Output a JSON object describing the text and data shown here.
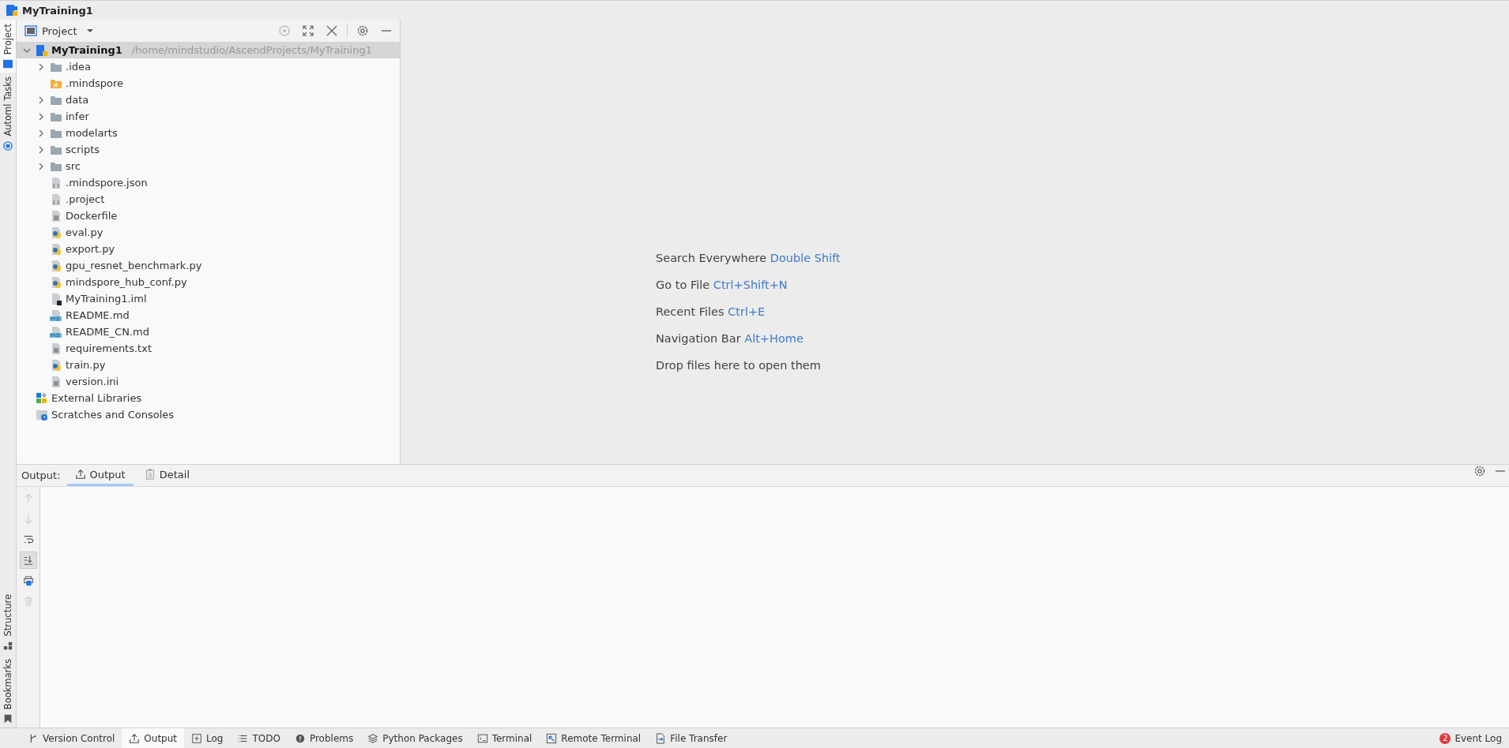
{
  "window": {
    "title": "MyTraining1"
  },
  "side_tabs_top": [
    {
      "label": "Project",
      "kind": "project",
      "selected": true
    },
    {
      "label": "Automl Tasks",
      "kind": "automl",
      "selected": false
    }
  ],
  "side_tabs_bottom": [
    {
      "label": "Structure",
      "kind": "structure",
      "selected": false
    },
    {
      "label": "Bookmarks",
      "kind": "bookmarks",
      "selected": false
    }
  ],
  "project_panel": {
    "view": "Project",
    "tree": [
      {
        "name": "MyTraining1",
        "path": "/home/mindstudio/AscendProjects/MyTraining1",
        "kind": "module",
        "expanded": true,
        "selected": true,
        "children": [
          {
            "name": ".idea",
            "kind": "folder",
            "expanded": false,
            "selected": false
          },
          {
            "name": ".mindspore",
            "kind": "mindspore",
            "selected": false
          },
          {
            "name": "data",
            "kind": "folder",
            "expanded": false,
            "selected": false
          },
          {
            "name": "infer",
            "kind": "folder",
            "expanded": false,
            "selected": false
          },
          {
            "name": "modelarts",
            "kind": "folder",
            "expanded": false,
            "selected": false
          },
          {
            "name": "scripts",
            "kind": "folder",
            "expanded": false,
            "selected": false
          },
          {
            "name": "src",
            "kind": "folder",
            "expanded": false,
            "selected": false
          },
          {
            "name": ".mindspore.json",
            "kind": "json",
            "selected": false
          },
          {
            "name": ".project",
            "kind": "project",
            "selected": false
          },
          {
            "name": "Dockerfile",
            "kind": "text",
            "selected": false
          },
          {
            "name": "eval.py",
            "kind": "python",
            "selected": false
          },
          {
            "name": "export.py",
            "kind": "python",
            "selected": false
          },
          {
            "name": "gpu_resnet_benchmark.py",
            "kind": "python",
            "selected": false
          },
          {
            "name": "mindspore_hub_conf.py",
            "kind": "python",
            "selected": false
          },
          {
            "name": "MyTraining1.iml",
            "kind": "iml",
            "selected": false
          },
          {
            "name": "README.md",
            "kind": "markdown",
            "selected": false
          },
          {
            "name": "README_CN.md",
            "kind": "markdown",
            "selected": false
          },
          {
            "name": "requirements.txt",
            "kind": "text",
            "selected": false
          },
          {
            "name": "train.py",
            "kind": "python",
            "selected": false
          },
          {
            "name": "version.ini",
            "kind": "text",
            "selected": false
          }
        ]
      },
      {
        "name": "External Libraries",
        "kind": "libraries",
        "selected": false
      },
      {
        "name": "Scratches and Consoles",
        "kind": "scratches",
        "selected": false
      }
    ]
  },
  "editor_hints": [
    {
      "action": "Search Everywhere",
      "shortcut": "Double Shift"
    },
    {
      "action": "Go to File",
      "shortcut": "Ctrl+Shift+N"
    },
    {
      "action": "Recent Files",
      "shortcut": "Ctrl+E"
    },
    {
      "action": "Navigation Bar",
      "shortcut": "Alt+Home"
    },
    {
      "action": "Drop files here to open them"
    }
  ],
  "output_panel": {
    "label": "Output:",
    "tabs": [
      {
        "label": "Output",
        "kind": "output",
        "selected": true
      },
      {
        "label": "Detail",
        "kind": "detail",
        "selected": false
      }
    ],
    "tools": [
      {
        "kind": "up",
        "disabled": true,
        "on": false
      },
      {
        "kind": "down",
        "disabled": true,
        "on": false
      },
      {
        "kind": "wrap",
        "disabled": false,
        "on": false
      },
      {
        "kind": "scroll",
        "disabled": false,
        "on": true
      },
      {
        "kind": "print",
        "disabled": false,
        "on": false
      },
      {
        "kind": "trash",
        "disabled": true,
        "on": false
      }
    ]
  },
  "status_bar": {
    "tabs": [
      {
        "label": "Version Control",
        "kind": "vcs",
        "selected": false
      },
      {
        "label": "Output",
        "kind": "output",
        "selected": true
      },
      {
        "label": "Log",
        "kind": "log",
        "selected": false
      },
      {
        "label": "TODO",
        "kind": "todo",
        "selected": false
      },
      {
        "label": "Problems",
        "kind": "problems",
        "selected": false
      },
      {
        "label": "Python Packages",
        "kind": "packages",
        "selected": false
      },
      {
        "label": "Terminal",
        "kind": "terminal",
        "selected": false
      },
      {
        "label": "Remote Terminal",
        "kind": "remote",
        "selected": false
      },
      {
        "label": "File Transfer",
        "kind": "transfer",
        "selected": false
      }
    ],
    "event_log": {
      "label": "Event Log",
      "count": "2"
    }
  }
}
